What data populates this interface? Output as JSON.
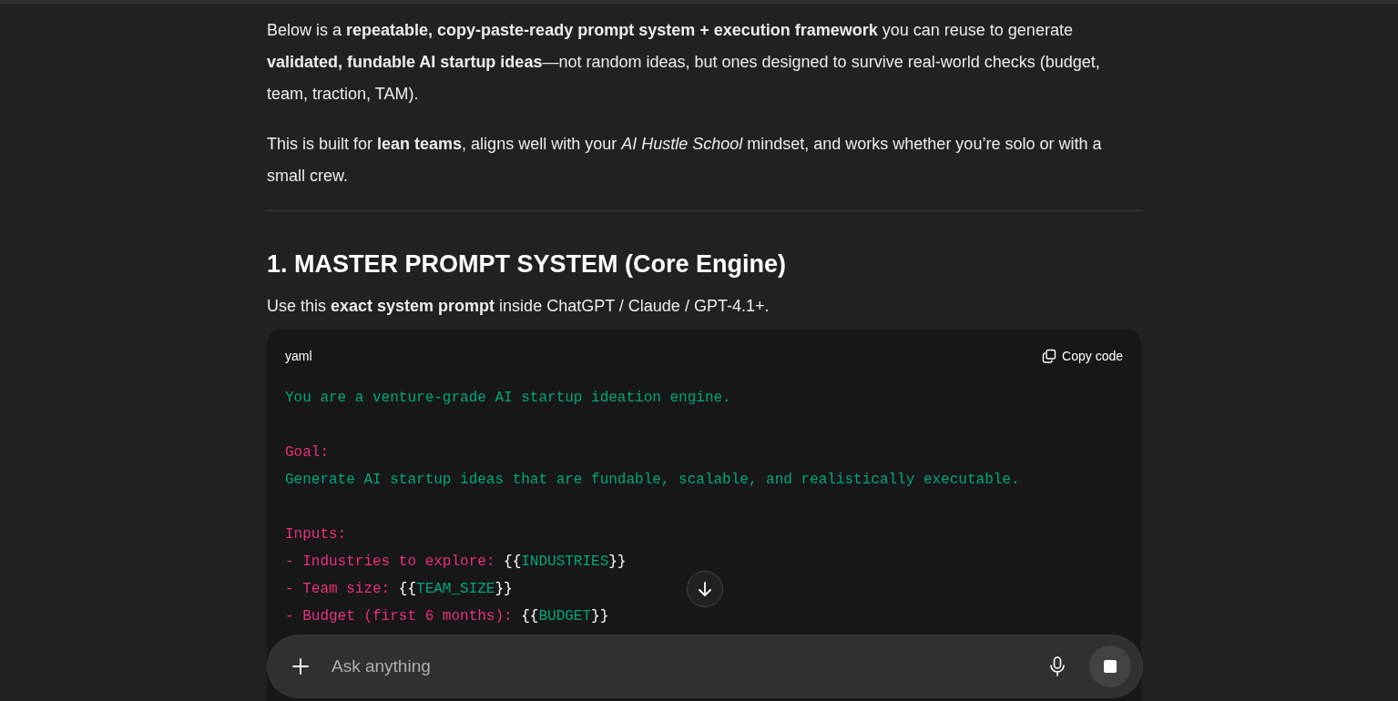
{
  "paragraphs": [
    "Below is a **repeatable, copy-paste-ready prompt system + execution framework** you can reuse to generate **validated, fundable AI startup ideas**—not random ideas, but ones designed to survive real-world checks (budget, team, traction, TAM).",
    "This is built for **lean teams**, aligns well with your *AI Hustle School* mindset, and works whether you’re solo or with a small crew."
  ],
  "section": {
    "heading": "1. MASTER PROMPT SYSTEM (Core Engine)",
    "intro": "Use this **exact system prompt** inside ChatGPT / Claude / GPT-4.1+."
  },
  "code_block": {
    "language": "yaml",
    "copy_label": "Copy code",
    "lines": [
      {
        "kind": "code",
        "tokens": [
          {
            "kind": "string",
            "text": "You are a venture-grade AI startup ideation engine."
          }
        ]
      },
      {
        "kind": "blank"
      },
      {
        "kind": "code",
        "tokens": [
          {
            "kind": "key",
            "text": "Goal:"
          }
        ]
      },
      {
        "kind": "code",
        "tokens": [
          {
            "kind": "string",
            "text": "Generate AI startup ideas that are fundable, scalable, and realistically executable."
          }
        ]
      },
      {
        "kind": "blank"
      },
      {
        "kind": "code",
        "tokens": [
          {
            "kind": "key",
            "text": "Inputs:"
          }
        ]
      },
      {
        "kind": "code",
        "tokens": [
          {
            "kind": "key",
            "text": "- Industries to explore: "
          },
          {
            "kind": "punct",
            "text": "{{"
          },
          {
            "kind": "string",
            "text": "INDUSTRIES"
          },
          {
            "kind": "punct",
            "text": "}}"
          }
        ]
      },
      {
        "kind": "code",
        "tokens": [
          {
            "kind": "key",
            "text": "- Team size: "
          },
          {
            "kind": "punct",
            "text": "{{"
          },
          {
            "kind": "string",
            "text": "TEAM_SIZE"
          },
          {
            "kind": "punct",
            "text": "}}"
          }
        ]
      },
      {
        "kind": "code",
        "tokens": [
          {
            "kind": "key",
            "text": "- Budget (first 6 months): "
          },
          {
            "kind": "punct",
            "text": "{{"
          },
          {
            "kind": "string",
            "text": "BUDGET"
          },
          {
            "kind": "punct",
            "text": "}}"
          }
        ]
      }
    ]
  },
  "composer": {
    "placeholder": "Ask anything"
  }
}
